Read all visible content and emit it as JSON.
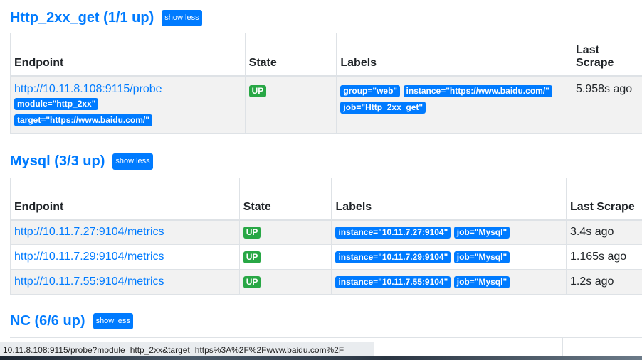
{
  "sections": [
    {
      "title": "Http_2xx_get (1/1 up)",
      "toggle": "show less",
      "headers": [
        "Endpoint",
        "State",
        "Labels",
        "Last Scrape"
      ],
      "rows": [
        {
          "endpoint": "http://10.11.8.108:9115/probe",
          "params": [
            "module=\"http_2xx\"",
            "target=\"https://www.baidu.com/\""
          ],
          "state": "UP",
          "labels": [
            "group=\"web\"",
            "instance=\"https://www.baidu.com/\"",
            "job=\"Http_2xx_get\""
          ],
          "last_scrape": "5.958s ago"
        }
      ]
    },
    {
      "title": "Mysql (3/3 up)",
      "toggle": "show less",
      "headers": [
        "Endpoint",
        "State",
        "Labels",
        "Last Scrape"
      ],
      "rows": [
        {
          "endpoint": "http://10.11.7.27:9104/metrics",
          "state": "UP",
          "labels": [
            "instance=\"10.11.7.27:9104\"",
            "job=\"Mysql\""
          ],
          "last_scrape": "3.4s ago"
        },
        {
          "endpoint": "http://10.11.7.29:9104/metrics",
          "state": "UP",
          "labels": [
            "instance=\"10.11.7.29:9104\"",
            "job=\"Mysql\""
          ],
          "last_scrape": "1.165s ago"
        },
        {
          "endpoint": "http://10.11.7.55:9104/metrics",
          "state": "UP",
          "labels": [
            "instance=\"10.11.7.55:9104\"",
            "job=\"Mysql\""
          ],
          "last_scrape": "1.2s ago"
        }
      ]
    },
    {
      "title": "NC (6/6 up)",
      "toggle": "show less"
    }
  ],
  "status_bar": {
    "url": "10.11.8.108:9115/probe?module=http_2xx&target=https%3A%2F%2Fwww.baidu.com%2F"
  },
  "colors": {
    "accent": "#007bff",
    "up": "#28a745"
  }
}
